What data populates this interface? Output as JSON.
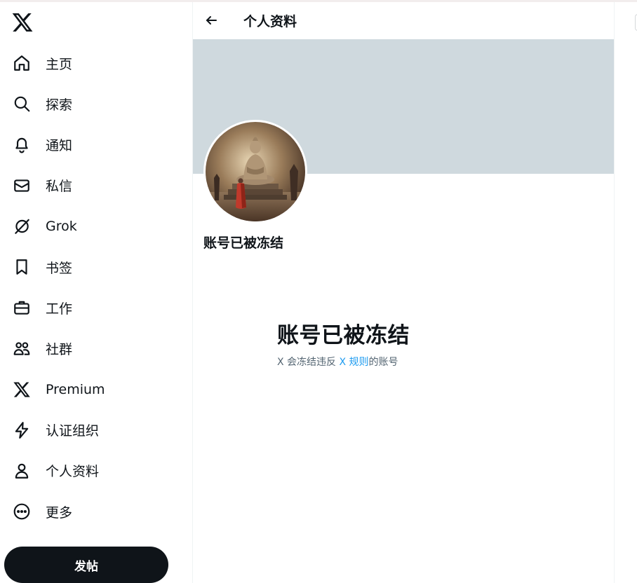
{
  "app": {
    "logo_icon": "x-logo-icon"
  },
  "sidebar": {
    "items": [
      {
        "label": "主页",
        "icon": "home-icon"
      },
      {
        "label": "探索",
        "icon": "search-icon"
      },
      {
        "label": "通知",
        "icon": "bell-icon"
      },
      {
        "label": "私信",
        "icon": "mail-icon"
      },
      {
        "label": "Grok",
        "icon": "grok-icon"
      },
      {
        "label": "书签",
        "icon": "bookmark-icon"
      },
      {
        "label": "工作",
        "icon": "briefcase-icon"
      },
      {
        "label": "社群",
        "icon": "people-icon"
      },
      {
        "label": "Premium",
        "icon": "x-logo-icon"
      },
      {
        "label": "认证组织",
        "icon": "lightning-icon"
      },
      {
        "label": "个人资料",
        "icon": "person-icon"
      },
      {
        "label": "更多",
        "icon": "more-circle-icon"
      }
    ],
    "post_button": "发帖"
  },
  "header": {
    "title": "个人资料",
    "back_icon": "back-arrow-icon"
  },
  "profile": {
    "display_name": "账号已被冻结",
    "avatar_icon": "buddha-statue-avatar"
  },
  "suspended": {
    "title": "账号已被冻结",
    "desc_prefix": "X 会冻结违反 ",
    "desc_link": "X 规则",
    "desc_suffix": "的账号"
  },
  "colors": {
    "text_primary": "#0f1419",
    "text_secondary": "#536471",
    "link": "#1d9bf0",
    "banner": "#cfd9de",
    "post_button_bg": "#0f1419"
  }
}
